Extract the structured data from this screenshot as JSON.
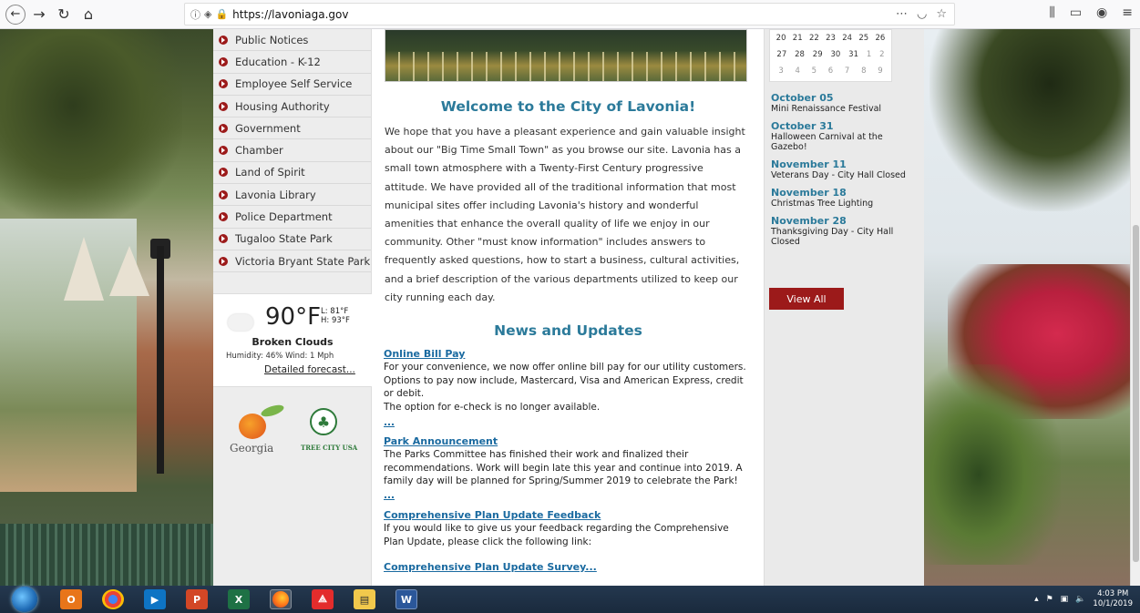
{
  "browser": {
    "url": "https://lavoniaga.gov"
  },
  "menu": {
    "items": [
      "Public Notices",
      "Education - K-12",
      "Employee Self Service",
      "Housing Authority",
      "Government",
      "Chamber",
      "Land of Spirit",
      "Lavonia Library",
      "Police Department",
      "Tugaloo State Park",
      "Victoria Bryant State Park"
    ]
  },
  "weather": {
    "temp": "90°F",
    "low": "L: 81°F",
    "high": "H: 93°F",
    "condition": "Broken Clouds",
    "details": "Humidity: 46%  Wind: 1 Mph",
    "forecast_link": "Detailed forecast..."
  },
  "logos": {
    "georgia": "Georgia",
    "tree_city": "TREE CITY USA"
  },
  "main": {
    "welcome_title": "Welcome to the City of Lavonia!",
    "intro": "We hope that you have a pleasant experience and gain valuable insight about our \"Big Time Small Town\" as you browse our site. Lavonia has a small town atmosphere with a Twenty-First Century progressive attitude. We have provided all of the traditional information that most municipal sites offer including Lavonia's history and wonderful amenities that enhance the overall quality of life we enjoy in our community. Other \"must know information\" includes answers to frequently asked questions, how to start a business, cultural activities, and a brief description of the various departments utilized to keep our city running each day.",
    "news_title": "News and Updates",
    "news": [
      {
        "title": "Online Bill Pay",
        "body": "For your convenience, we now offer online bill pay for our utility customers. Options to pay now include, Mastercard, Visa and American Express, credit or debit.",
        "body2": "The option for e-check is no longer available.",
        "more": "..."
      },
      {
        "title": "Park Announcement",
        "body": "The Parks Committee has finished their work and finalized their recommendations. Work will begin late this year and continue into 2019. A family day will be planned for Spring/Summer 2019 to celebrate the Park!",
        "more": "..."
      },
      {
        "title": "Comprehensive Plan Update Feedback",
        "body": "If you would like to give us your feedback regarding the Comprehensive Plan Update, please click the following link:",
        "link": "Comprehensive Plan Update Survey..."
      }
    ]
  },
  "calendar": {
    "rows": [
      [
        "20",
        "21",
        "22",
        "23",
        "24",
        "25",
        "26"
      ],
      [
        "27",
        "28",
        "29",
        "30",
        "31",
        "1",
        "2"
      ],
      [
        "3",
        "4",
        "5",
        "6",
        "7",
        "8",
        "9"
      ]
    ]
  },
  "events": [
    {
      "date": "October 05",
      "name": "Mini Renaissance Festival"
    },
    {
      "date": "October 31",
      "name": "Halloween Carnival at the Gazebo!"
    },
    {
      "date": "November 11",
      "name": "Veterans Day - City Hall Closed"
    },
    {
      "date": "November 18",
      "name": "Christmas Tree Lighting"
    },
    {
      "date": "November 28",
      "name": "Thanksgiving Day - City Hall Closed"
    }
  ],
  "view_all": "View All",
  "taskbar": {
    "time": "4:03 PM",
    "date": "10/1/2019"
  },
  "colors": {
    "accent_red": "#9c1a1a",
    "heading_blue": "#2b7a9a",
    "link_blue": "#1a6aa0"
  }
}
